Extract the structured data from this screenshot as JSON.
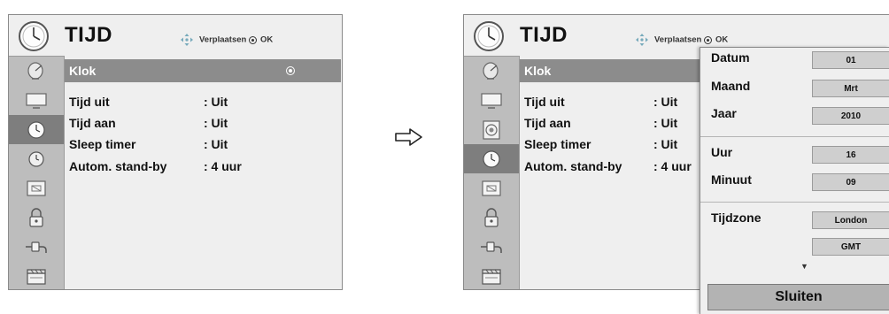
{
  "left_menu": {
    "title": "TIJD",
    "nav_hint": "Verplaatsen",
    "ok_label": "OK",
    "selected": "Klok",
    "rows": [
      {
        "label": "Tijd uit",
        "value": ": Uit"
      },
      {
        "label": "Tijd aan",
        "value": ": Uit"
      },
      {
        "label": "Sleep timer",
        "value": ": Uit"
      },
      {
        "label": "Autom. stand-by",
        "value": ": 4 uur"
      }
    ],
    "sidebar_icons": [
      "satellite-dish-icon",
      "monitor-icon",
      "clock-icon",
      "clock-small-icon",
      "lock-frame-icon",
      "padlock-icon",
      "plug-icon",
      "clapper-icon"
    ]
  },
  "right_menu": {
    "title": "TIJD",
    "nav_hint": "Verplaatsen",
    "ok_label": "OK",
    "selected": "Klok",
    "rows": [
      {
        "label": "Tijd uit",
        "value": ": Uit"
      },
      {
        "label": "Tijd aan",
        "value": ": Uit"
      },
      {
        "label": "Sleep timer",
        "value": ": Uit"
      },
      {
        "label": "Autom. stand-by",
        "value": ": 4 uur"
      }
    ]
  },
  "popup": {
    "fields": [
      {
        "label": "Datum",
        "value": "01"
      },
      {
        "label": "Maand",
        "value": "Mrt"
      },
      {
        "label": "Jaar",
        "value": "2010"
      },
      {
        "label": "Uur",
        "value": "16"
      },
      {
        "label": "Minuut",
        "value": "09"
      },
      {
        "label": "Tijdzone",
        "value": "London"
      },
      {
        "label": "",
        "value": "GMT"
      }
    ],
    "more_indicator": "▼",
    "close_label": "Sluiten"
  },
  "colors": {
    "menu_bg": "#efefef",
    "sidebar_bg": "#bdbdbd",
    "selected_bar": "#8c8c8c",
    "active_sidebar": "#7e7e7e",
    "value_box": "#cfcfcf"
  }
}
